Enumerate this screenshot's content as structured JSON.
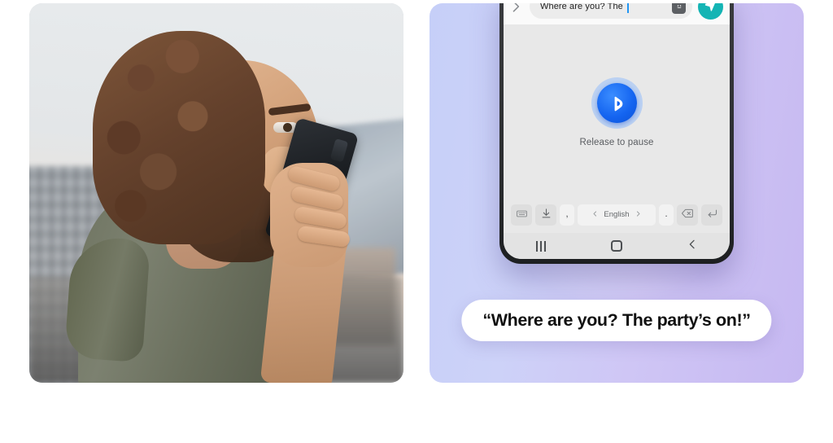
{
  "left_panel": {
    "name": "photo-of-man-using-voice-input",
    "alt": "Young man with curly hair and beard holding a black smartphone near his mouth, speaking into it, blurred city waterfront background"
  },
  "right_panel": {
    "gradient_from": "#c6cff8",
    "gradient_to": "#c6b8f1",
    "phone": {
      "input_bar": {
        "expand_icon": "chevron-right-icon",
        "text_value": "Where are you? The",
        "caret_color": "#2196f3",
        "sticker_icon": "sticker-icon",
        "send_icon": "send-paper-plane-icon",
        "send_color": "#14b4b4"
      },
      "voice_panel": {
        "assistant_icon": "bixby-icon",
        "assistant_color": "#1464f0",
        "status_text": "Release to pause"
      },
      "keyboard_row": {
        "keys": [
          {
            "name": "keyboard-toggle-key",
            "icon": "keyboard-icon",
            "label": ""
          },
          {
            "name": "keyboard-hide-key",
            "icon": "download-icon",
            "label": ""
          },
          {
            "name": "comma-key",
            "icon": "",
            "label": ","
          },
          {
            "name": "language-key",
            "icon": "language-chevrons",
            "label": "English"
          },
          {
            "name": "period-key",
            "icon": "",
            "label": "."
          },
          {
            "name": "backspace-key",
            "icon": "backspace-icon",
            "label": ""
          },
          {
            "name": "enter-key",
            "icon": "enter-return-icon",
            "label": ""
          }
        ],
        "lang_prev_icon": "chevron-left-icon",
        "lang_next_icon": "chevron-right-icon"
      },
      "nav_bar": {
        "recents_label": "recents-icon",
        "home_label": "home-icon",
        "back_label": "back-icon"
      }
    },
    "caption": {
      "text": "“Where are you? The party’s on!”"
    }
  }
}
